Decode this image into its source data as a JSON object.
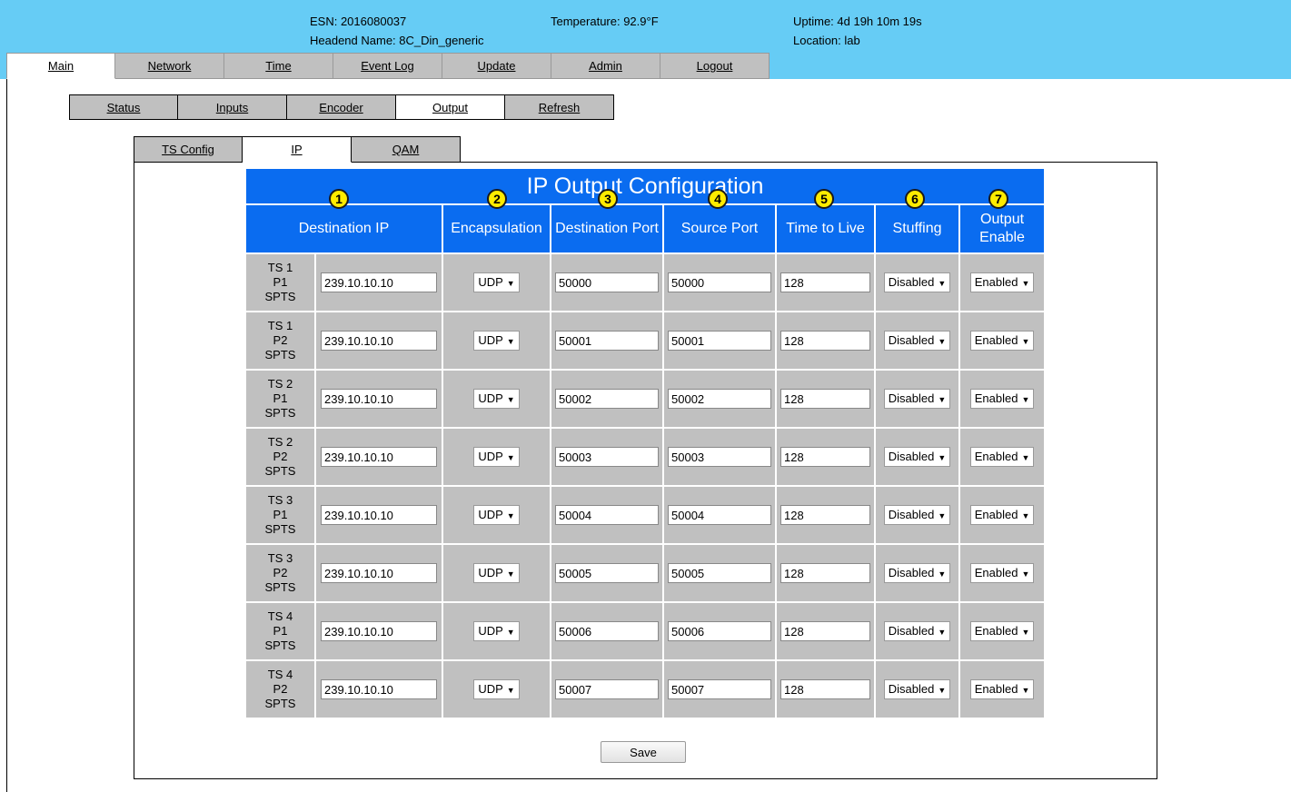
{
  "header": {
    "esn": "ESN: 2016080037",
    "headend_name": "Headend Name: 8C_Din_generic",
    "temperature": "Temperature: 92.9°F",
    "uptime": "Uptime: 4d 19h 10m 19s",
    "location": "Location: lab"
  },
  "main_nav": [
    "Main",
    "Network",
    "Time",
    "Event Log",
    "Update",
    "Admin",
    "Logout"
  ],
  "sub_nav": [
    "Status",
    "Inputs",
    "Encoder",
    "Output",
    "Refresh"
  ],
  "third_nav": [
    "TS Config",
    "IP",
    "QAM"
  ],
  "table": {
    "title": "IP Output Configuration",
    "columns": [
      "Destination IP",
      "Encapsulation",
      "Destination Port",
      "Source Port",
      "Time to Live",
      "Stuffing",
      "Output Enable"
    ],
    "rows": [
      {
        "ts": "TS 1",
        "p": "P1",
        "type": "SPTS",
        "dest_ip": "239.10.10.10",
        "encap": "UDP",
        "dest_port": "50000",
        "src_port": "50000",
        "ttl": "128",
        "stuffing": "Disabled",
        "enable": "Enabled"
      },
      {
        "ts": "TS 1",
        "p": "P2",
        "type": "SPTS",
        "dest_ip": "239.10.10.10",
        "encap": "UDP",
        "dest_port": "50001",
        "src_port": "50001",
        "ttl": "128",
        "stuffing": "Disabled",
        "enable": "Enabled"
      },
      {
        "ts": "TS 2",
        "p": "P1",
        "type": "SPTS",
        "dest_ip": "239.10.10.10",
        "encap": "UDP",
        "dest_port": "50002",
        "src_port": "50002",
        "ttl": "128",
        "stuffing": "Disabled",
        "enable": "Enabled"
      },
      {
        "ts": "TS 2",
        "p": "P2",
        "type": "SPTS",
        "dest_ip": "239.10.10.10",
        "encap": "UDP",
        "dest_port": "50003",
        "src_port": "50003",
        "ttl": "128",
        "stuffing": "Disabled",
        "enable": "Enabled"
      },
      {
        "ts": "TS 3",
        "p": "P1",
        "type": "SPTS",
        "dest_ip": "239.10.10.10",
        "encap": "UDP",
        "dest_port": "50004",
        "src_port": "50004",
        "ttl": "128",
        "stuffing": "Disabled",
        "enable": "Enabled"
      },
      {
        "ts": "TS 3",
        "p": "P2",
        "type": "SPTS",
        "dest_ip": "239.10.10.10",
        "encap": "UDP",
        "dest_port": "50005",
        "src_port": "50005",
        "ttl": "128",
        "stuffing": "Disabled",
        "enable": "Enabled"
      },
      {
        "ts": "TS 4",
        "p": "P1",
        "type": "SPTS",
        "dest_ip": "239.10.10.10",
        "encap": "UDP",
        "dest_port": "50006",
        "src_port": "50006",
        "ttl": "128",
        "stuffing": "Disabled",
        "enable": "Enabled"
      },
      {
        "ts": "TS 4",
        "p": "P2",
        "type": "SPTS",
        "dest_ip": "239.10.10.10",
        "encap": "UDP",
        "dest_port": "50007",
        "src_port": "50007",
        "ttl": "128",
        "stuffing": "Disabled",
        "enable": "Enabled"
      }
    ]
  },
  "badges": [
    "1",
    "2",
    "3",
    "4",
    "5",
    "6",
    "7"
  ],
  "save_label": "Save",
  "colors": {
    "header_bg": "#66ccf5",
    "table_header": "#0a6cf0",
    "cell_bg": "#c0c0c0",
    "badge": "#ffeb00"
  }
}
